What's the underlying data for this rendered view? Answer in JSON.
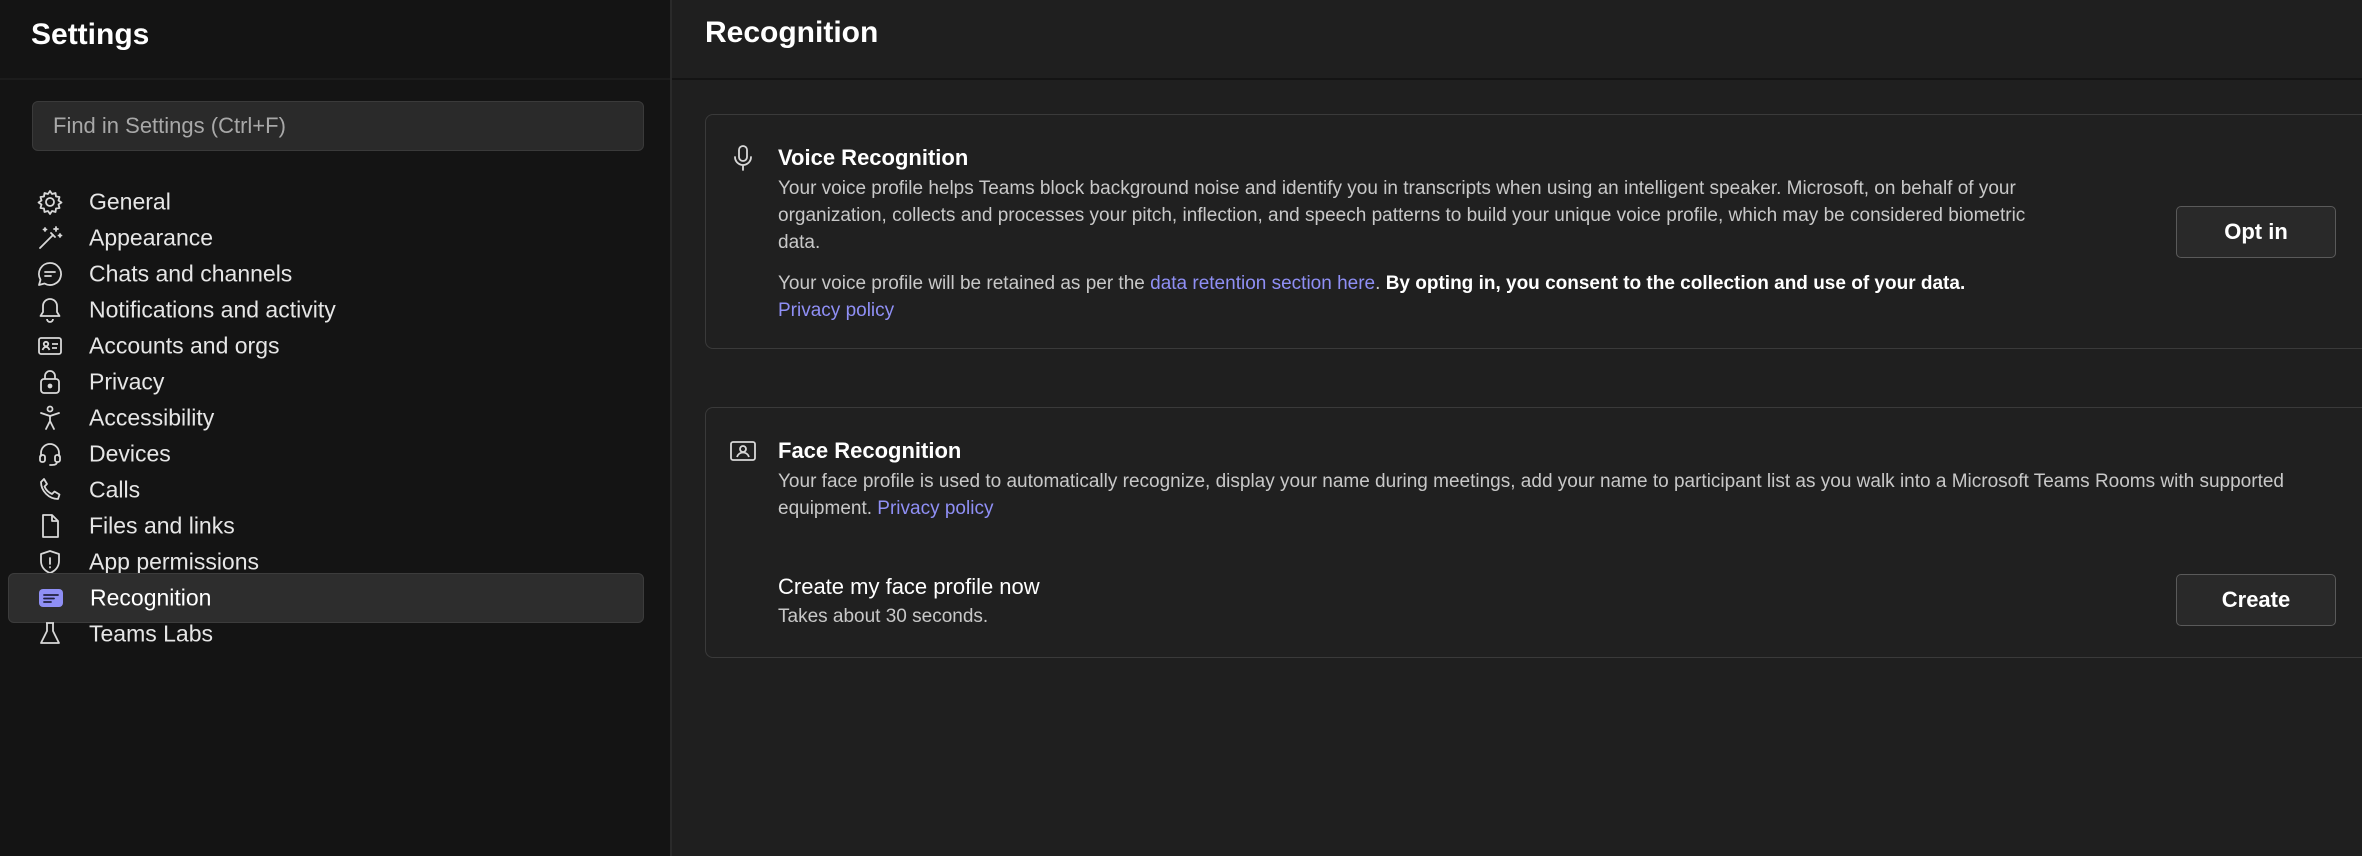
{
  "sidebar": {
    "title": "Settings",
    "search_placeholder": "Find in Settings (Ctrl+F)",
    "items": [
      {
        "label": "General",
        "icon": "gear-icon"
      },
      {
        "label": "Appearance",
        "icon": "magic-wand-icon"
      },
      {
        "label": "Chats and channels",
        "icon": "chat-bubble-icon"
      },
      {
        "label": "Notifications and activity",
        "icon": "bell-icon"
      },
      {
        "label": "Accounts and orgs",
        "icon": "contact-card-icon"
      },
      {
        "label": "Privacy",
        "icon": "lock-icon"
      },
      {
        "label": "Accessibility",
        "icon": "accessibility-icon"
      },
      {
        "label": "Devices",
        "icon": "headset-icon"
      },
      {
        "label": "Calls",
        "icon": "phone-icon"
      },
      {
        "label": "Files and links",
        "icon": "document-icon"
      },
      {
        "label": "App permissions",
        "icon": "shield-icon"
      },
      {
        "label": "Recognition",
        "icon": "recognition-icon",
        "active": true
      },
      {
        "label": "Teams Labs",
        "icon": "flask-icon"
      }
    ]
  },
  "main": {
    "title": "Recognition",
    "voice": {
      "title": "Voice Recognition",
      "icon": "microphone-icon",
      "desc": "Your voice profile helps Teams block background noise and identify you in transcripts when using an intelligent speaker. Microsoft, on behalf of your organization, collects and processes your pitch, inflection, and speech patterns to build your unique voice profile, which may be considered biometric data.",
      "retention_prefix": "Your voice profile will be retained as per the ",
      "retention_link": "data retention section here",
      "retention_suffix": ". ",
      "consent": "By opting in, you consent to the collection and use of your data.",
      "privacy_link": "Privacy policy",
      "button": "Opt in"
    },
    "face": {
      "title": "Face Recognition",
      "icon": "face-id-icon",
      "desc": "Your face profile is used to automatically recognize, display your name during meetings, add your name to participant list as you walk into a Microsoft Teams Rooms with supported equipment. ",
      "privacy_link": "Privacy policy",
      "create_title": "Create my face profile now",
      "create_desc": "Takes about 30 seconds.",
      "button": "Create"
    }
  },
  "colors": {
    "accent": "#8f8ff5",
    "background": "#1f1f1f",
    "sidebar": "#141414"
  }
}
